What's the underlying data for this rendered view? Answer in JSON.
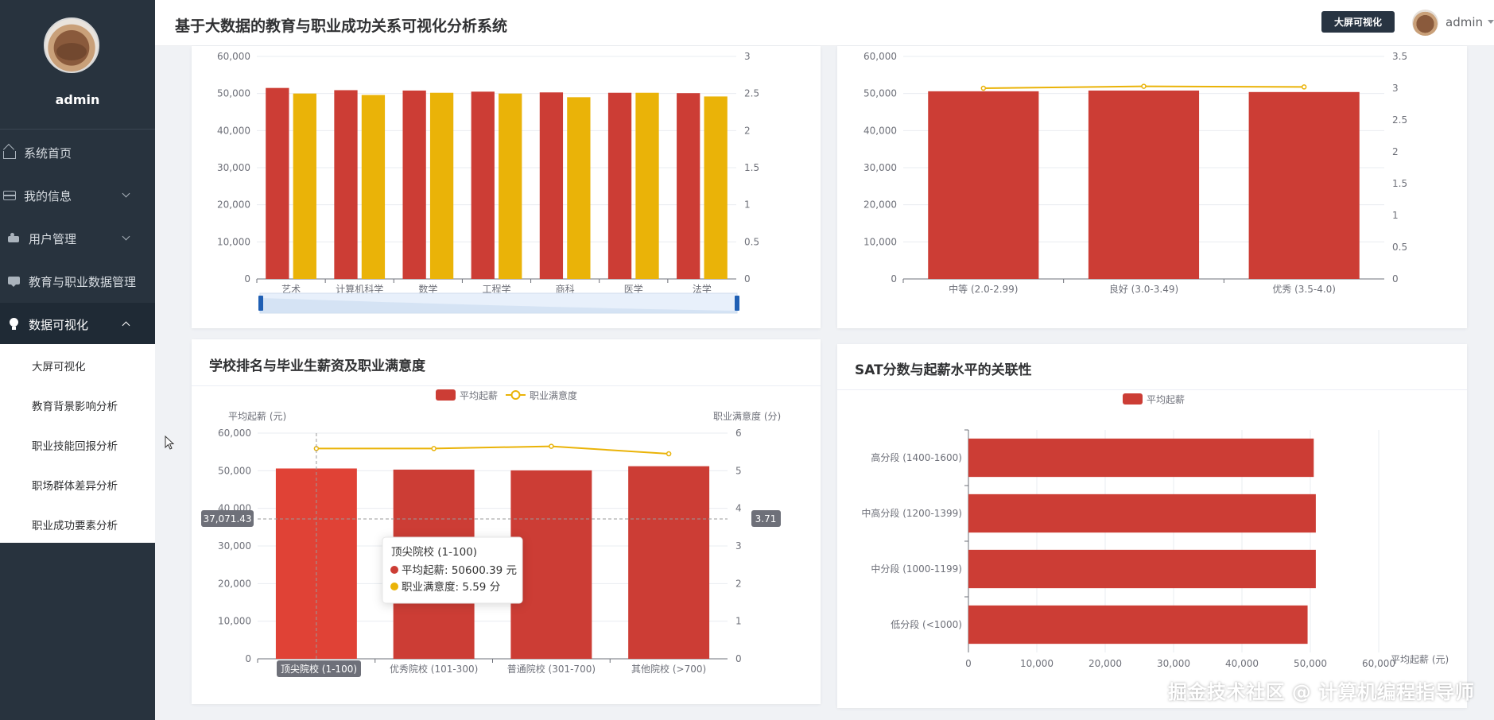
{
  "sidebar": {
    "user_name": "admin",
    "menu": [
      {
        "label": "系统首页"
      },
      {
        "label": "我的信息"
      },
      {
        "label": "用户管理"
      },
      {
        "label": "教育与职业数据管理"
      },
      {
        "label": "数据可视化"
      }
    ],
    "submenu": [
      {
        "label": "大屏可视化"
      },
      {
        "label": "教育背景影响分析"
      },
      {
        "label": "职业技能回报分析"
      },
      {
        "label": "职场群体差异分析"
      },
      {
        "label": "职业成功要素分析"
      }
    ]
  },
  "header": {
    "title": "基于大数据的教育与职业成功关系可视化分析系统",
    "bigscreen_button": "大屏可视化",
    "user": "admin"
  },
  "colors": {
    "bar": "#cc3d35",
    "bar_highlight": "#e04236",
    "line": "#eab308",
    "sidebar": "#28333e"
  },
  "chart_data": [
    {
      "type": "bar",
      "categories": [
        "艺术",
        "计算机科学",
        "数学",
        "工程学",
        "商科",
        "医学",
        "法学"
      ],
      "series": [
        {
          "values": [
            51500,
            50900,
            50800,
            50500,
            50300,
            50200,
            50100
          ]
        },
        {
          "values": [
            2.5,
            2.48,
            2.51,
            2.5,
            2.45,
            2.51,
            2.46
          ]
        }
      ],
      "ylim": [
        0,
        60000
      ],
      "ylim_right": [
        0,
        3
      ],
      "yticks": [
        "0",
        "10,000",
        "20,000",
        "30,000",
        "40,000",
        "50,000",
        "60,000"
      ],
      "yticks_right": [
        "0",
        "0.5",
        "1",
        "1.5",
        "2",
        "2.5",
        "3"
      ],
      "datazoom": true
    },
    {
      "type": "bar",
      "categories": [
        "中等 (2.0-2.99)",
        "良好 (3.0-3.49)",
        "优秀 (3.5-4.0)"
      ],
      "series": [
        {
          "values": [
            50600,
            50800,
            50400
          ]
        },
        {
          "values": [
            3.0,
            3.03,
            3.02
          ]
        }
      ],
      "ylim": [
        0,
        60000
      ],
      "ylim_right": [
        0,
        3.5
      ],
      "yticks": [
        "0",
        "10,000",
        "20,000",
        "30,000",
        "40,000",
        "50,000",
        "60,000"
      ],
      "yticks_right": [
        "0",
        "0.5",
        "1",
        "1.5",
        "2",
        "2.5",
        "3",
        "3.5"
      ]
    },
    {
      "type": "bar",
      "title": "学校排名与毕业生薪资及职业满意度",
      "categories": [
        "顶尖院校 (1-100)",
        "优秀院校 (101-300)",
        "普通院校 (301-700)",
        "其他院校 (>700)"
      ],
      "series": [
        {
          "name": "平均起薪",
          "values": [
            50600.39,
            50300,
            50100,
            51200
          ]
        },
        {
          "name": "职业满意度",
          "values": [
            5.59,
            5.59,
            5.65,
            5.45
          ]
        }
      ],
      "ylabel": "平均起薪 (元)",
      "ylabel_right": "职业满意度 (分)",
      "ylim": [
        0,
        60000
      ],
      "ylim_right": [
        0,
        6
      ],
      "yticks": [
        "0",
        "10,000",
        "20,000",
        "30,000",
        "40,000",
        "50,000",
        "60,000"
      ],
      "yticks_right": [
        "0",
        "1",
        "2",
        "3",
        "4",
        "5",
        "6"
      ],
      "crosshair": {
        "left_label": "37,071.43",
        "right_label": "3.71"
      },
      "tooltip": {
        "title": "顶尖院校 (1-100)",
        "rows": [
          {
            "label": "平均起薪",
            "value": "50600.39 元"
          },
          {
            "label": "职业满意度",
            "value": "5.59 分"
          }
        ]
      }
    },
    {
      "type": "bar",
      "orientation": "horizontal",
      "title": "SAT分数与起薪水平的关联性",
      "categories": [
        "高分段 (1400-1600)",
        "中高分段 (1200-1399)",
        "中分段 (1000-1199)",
        "低分段 (<1000)"
      ],
      "series": [
        {
          "name": "平均起薪",
          "values": [
            50500,
            50800,
            50800,
            49600
          ]
        }
      ],
      "xlabel": "平均起薪 (元)",
      "xlim": [
        0,
        60000
      ],
      "xticks": [
        "0",
        "10,000",
        "20,000",
        "30,000",
        "40,000",
        "50,000",
        "60,000"
      ]
    }
  ],
  "watermark": "掘金技术社区 @ 计算机编程指导师"
}
